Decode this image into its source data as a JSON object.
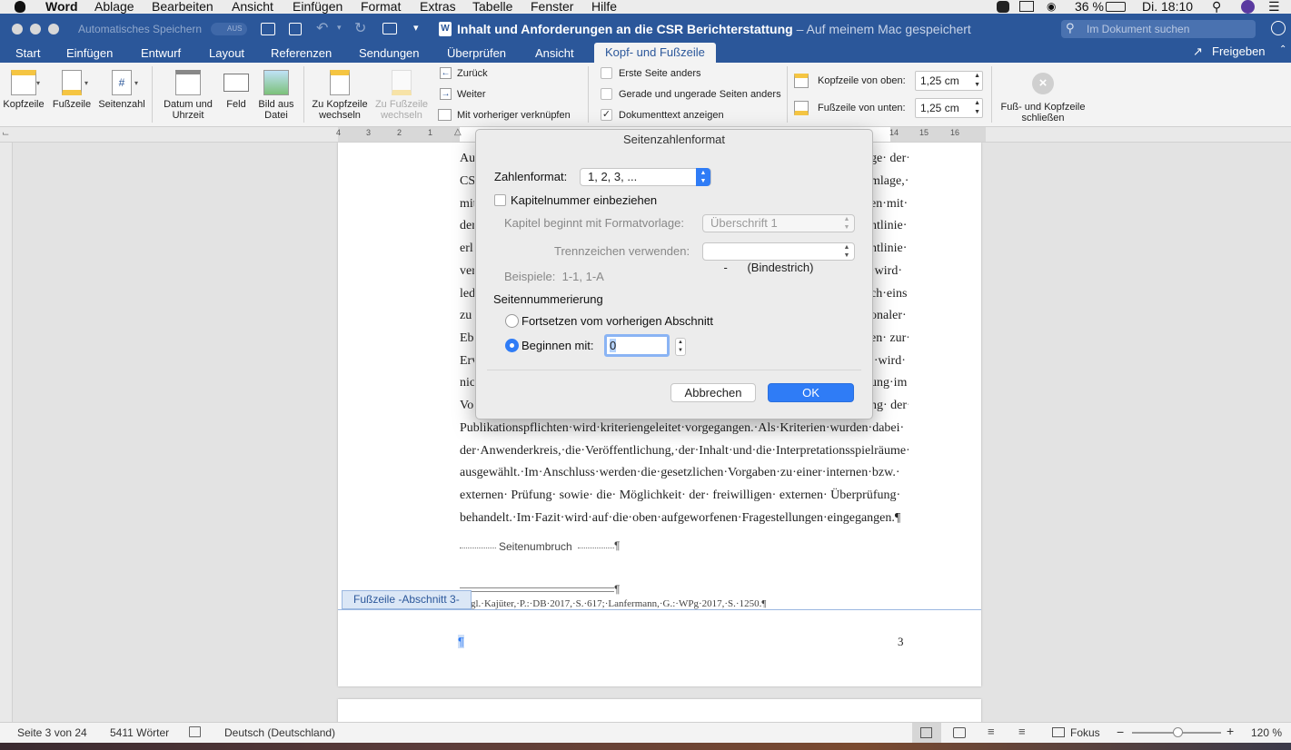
{
  "menubar": {
    "app": "Word",
    "items": [
      "Ablage",
      "Bearbeiten",
      "Ansicht",
      "Einfügen",
      "Format",
      "Extras",
      "Tabelle",
      "Fenster",
      "Hilfe"
    ],
    "battery": "36 %",
    "clock": "Di. 18:10"
  },
  "titlebar": {
    "autosave_label": "Automatisches Speichern",
    "autosave_state": "AUS",
    "doc_title": "Inhalt und Anforderungen an die CSR Berichterstattung",
    "doc_suffix": " – Auf meinem Mac gespeichert",
    "search_placeholder": "Im Dokument suchen"
  },
  "tabs": {
    "items": [
      "Start",
      "Einfügen",
      "Entwurf",
      "Layout",
      "Referenzen",
      "Sendungen",
      "Überprüfen",
      "Ansicht",
      "Kopf- und Fußzeile"
    ],
    "active": "Kopf- und Fußzeile",
    "share": "Freigeben"
  },
  "ribbon": {
    "kopfzeile": "Kopfzeile",
    "fusszeile": "Fußzeile",
    "seitenzahl": "Seitenzahl",
    "datum1": "Datum und",
    "datum2": "Uhrzeit",
    "feld": "Feld",
    "bild1": "Bild aus",
    "bild2": "Datei",
    "zukopf1": "Zu Kopfzeile",
    "zukopf2": "wechseln",
    "zufuss1": "Zu Fußzeile",
    "zufuss2": "wechseln",
    "zurueck": "Zurück",
    "weiter": "Weiter",
    "verknuepfen": "Mit vorheriger verknüpfen",
    "erste": "Erste Seite anders",
    "gerade": "Gerade und ungerade Seiten anders",
    "doktext": "Dokumenttext anzeigen",
    "kopfoben": "Kopfzeile von oben:",
    "kopfoben_val": "1,25 cm",
    "fussunten": "Fußzeile von unten:",
    "fussunten_val": "1,25 cm",
    "schliessen1": "Fuß- und Kopfzeile",
    "schliessen2": "schließen"
  },
  "ruler": {
    "left_ticks": [
      "4",
      "3",
      "2",
      "1"
    ],
    "right_ticks": [
      "14",
      "15",
      "16"
    ]
  },
  "document": {
    "left_fragments": [
      "Au",
      "CS",
      "mit",
      "der",
      "erl",
      "ver",
      "led",
      "zu",
      "Ebe",
      "Erv",
      "nic",
      "Vo"
    ],
    "right_fragments": [
      "ge· der·",
      "mlage,·",
      "en·mit·",
      "htlinie·",
      "htlinie·",
      "·wird·",
      "ch·eins·",
      "onaler·",
      "en· zur·",
      ":·wird·",
      "ung·im·",
      "ng· der·"
    ],
    "full_lines": [
      "Publikationspflichten·wird·kriteriengeleitet·vorgegangen.·Als·Kriterien·wurden·dabei·",
      "der·Anwenderkreis,·die·Veröffentlichung,·der·Inhalt·und·die·Interpretationsspielräume·",
      "ausgewählt.·Im·Anschluss·werden·die·gesetzlichen·Vorgaben·zu·einer·internen·bzw.·",
      "externen· Prüfung· sowie· die· Möglichkeit· der· freiwilligen· externen· Überprüfung·",
      "behandelt.·Im·Fazit·wird·auf·die·oben·aufgeworfenen·Fragestellungen·eingegangen.¶"
    ],
    "page_break": "Seitenumbruch",
    "footnote": "gl.·Kajüter,·P.:·DB·2017,·S.·617;·Lanfermann,·G.:·WPg·2017,·S.·1250.¶",
    "footer_tag": "Fußzeile -Abschnitt 3-",
    "footer_mark": "¶",
    "page_number": "3"
  },
  "dialog": {
    "title": "Seitenzahlenformat",
    "zahlenformat_label": "Zahlenformat:",
    "zahlenformat_value": "1, 2, 3, ...",
    "kapitel_check": "Kapitelnummer einbeziehen",
    "kapitel_beginnt": "Kapitel beginnt mit Formatvorlage:",
    "kapitel_beginnt_value": "Überschrift 1",
    "trennzeichen": "Trennzeichen verwenden:",
    "trennzeichen_value": "-      (Bindestrich)",
    "beispiele": "Beispiele:  1-1, 1-A",
    "seitennummerierung": "Seitennummerierung",
    "fortsetzen": "Fortsetzen vom vorherigen Abschnitt",
    "beginnen": "Beginnen mit:",
    "beginnen_value": "0",
    "cancel": "Abbrechen",
    "ok": "OK"
  },
  "statusbar": {
    "page": "Seite 3 von 24",
    "words": "5411 Wörter",
    "language": "Deutsch (Deutschland)",
    "focus": "Fokus",
    "zoom": "120 %"
  },
  "colors": {
    "titlebar": "#2b579a",
    "accent": "#2f7cf6"
  }
}
